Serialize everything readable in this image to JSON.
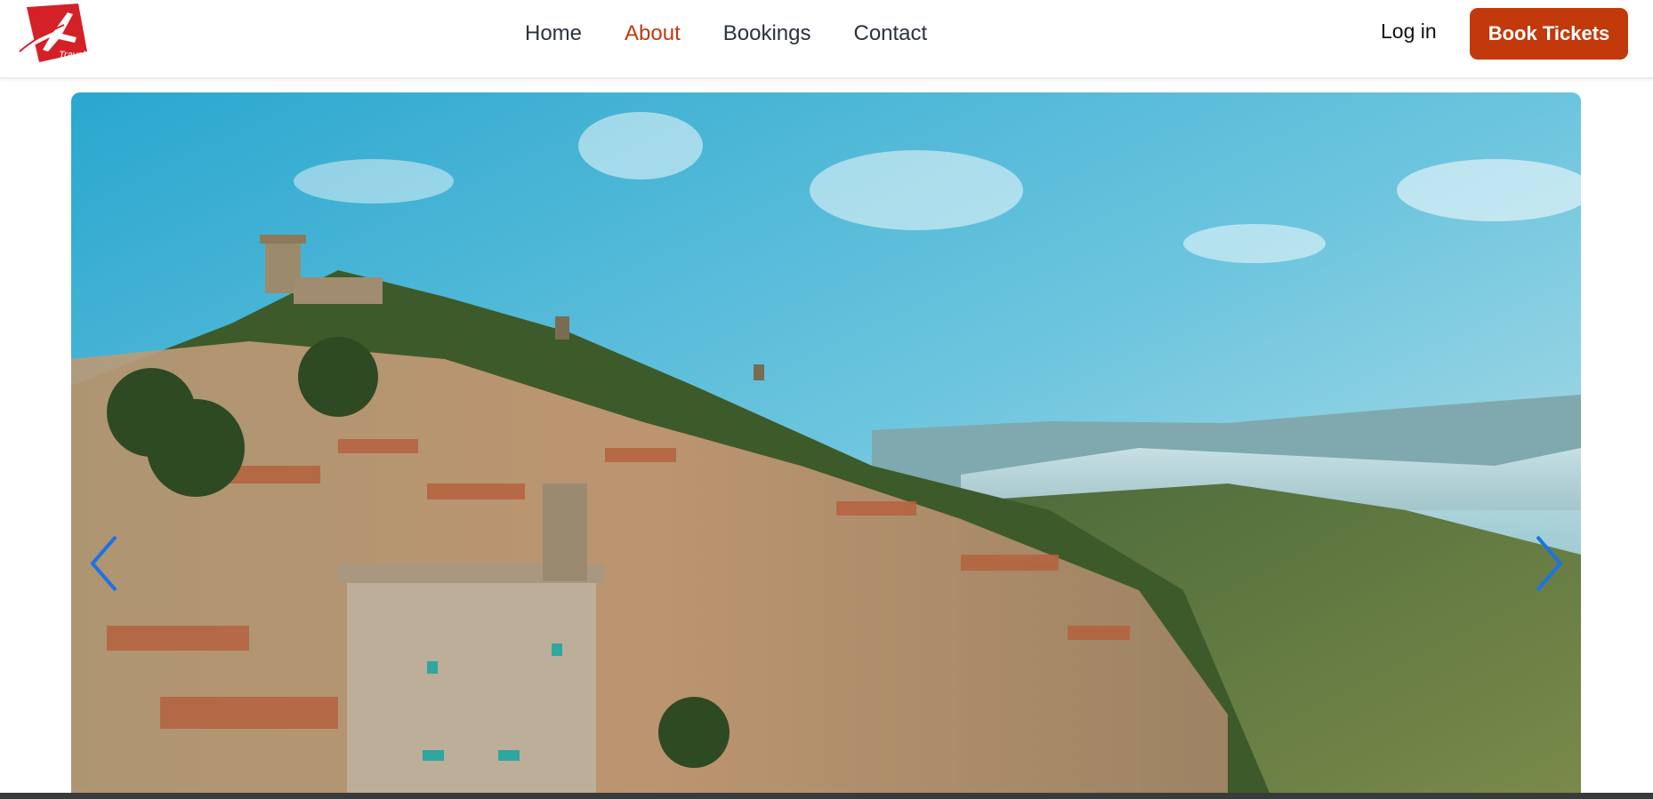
{
  "brand": {
    "logo_text": "Travel",
    "logo_icon": "airplane-icon",
    "logo_color": "#d42027"
  },
  "nav": {
    "items": [
      {
        "label": "Home",
        "active": false
      },
      {
        "label": "About",
        "active": true
      },
      {
        "label": "Bookings",
        "active": false
      },
      {
        "label": "Contact",
        "active": false
      }
    ],
    "active_color": "#c2390c",
    "text_color": "#2b3240"
  },
  "auth": {
    "login_label": "Log in",
    "cta_label": "Book Tickets",
    "cta_color": "#c23a0c"
  },
  "hero": {
    "image_subject": "aerial view of a hilltop town",
    "prev_icon": "chevron-left-icon",
    "next_icon": "chevron-right-icon",
    "arrow_color": "#1a73e8"
  }
}
